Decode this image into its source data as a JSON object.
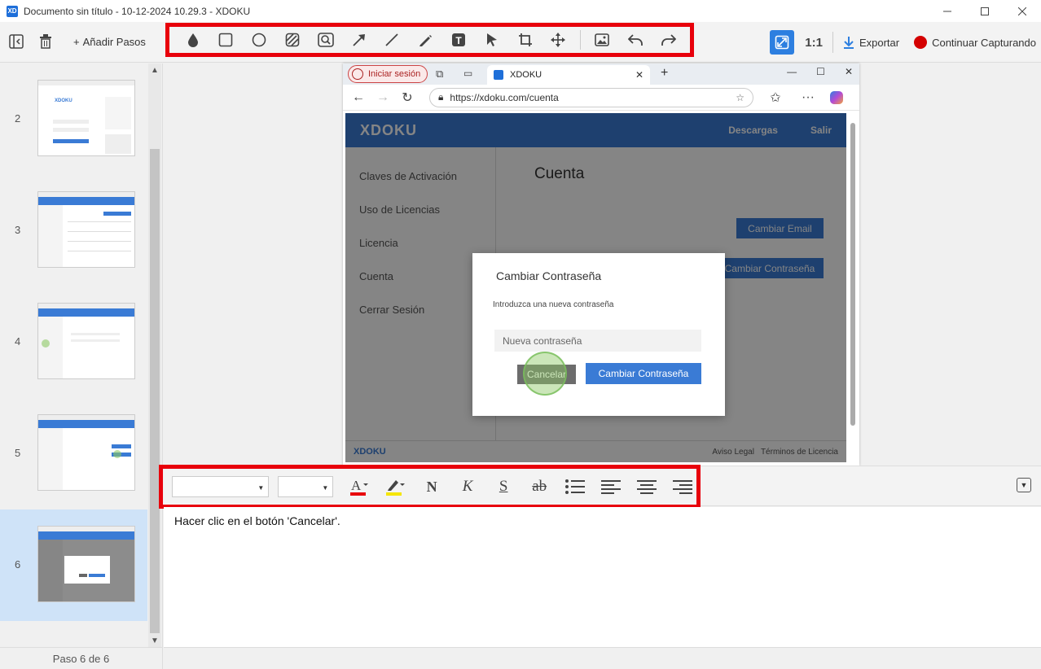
{
  "window": {
    "app_logo": "XD",
    "title": "Documento sin título - 10-12-2024 10.29.3 - XDOKU",
    "minimize_icon": "minimize-icon",
    "maximize_icon": "maximize-icon",
    "close_icon": "close-icon"
  },
  "toolbar": {
    "add_steps_label": "Añadir Pasos",
    "one_to_one_label": "1:1",
    "export_label": "Exportar",
    "continue_capture_label": "Continuar Capturando",
    "accent_color": "#2d7fe0",
    "highlight_border_color": "#e8000b",
    "draw_tools": [
      "drop-icon",
      "rectangle-icon",
      "ellipse-icon",
      "hatch-icon",
      "magnifier-icon",
      "arrow-icon",
      "line-icon",
      "pen-icon",
      "text-icon",
      "cursor-icon",
      "crop-icon",
      "move-icon",
      "image-icon",
      "undo-icon",
      "redo-icon"
    ]
  },
  "sidebar": {
    "steps": [
      {
        "number": "2"
      },
      {
        "number": "3"
      },
      {
        "number": "4"
      },
      {
        "number": "5"
      },
      {
        "number": "6",
        "selected": true
      }
    ],
    "footer": "Paso 6 de 6",
    "selected_color": "#cfe3f8"
  },
  "screenshot": {
    "signin_label": "Iniciar sesión",
    "tab_title": "XDOKU",
    "tab_logo": "XD",
    "url": "https://xdoku.com/cuenta",
    "site": {
      "logo": "XDOKU",
      "nav": [
        "Descargas",
        "Salir"
      ],
      "sidebar_items": [
        "Claves de Activación",
        "Uso de Licencias",
        "Licencia",
        "Cuenta",
        "Cerrar Sesión"
      ],
      "page_title": "Cuenta",
      "change_email_label": "Cambiar Email",
      "change_password_bg_label": "Cambiar Contraseña",
      "footer_logo": "XDOKU",
      "footer_links": [
        "Aviso Legal",
        "Términos de Licencia"
      ],
      "brand_color": "#3a7bd5"
    },
    "dialog": {
      "title": "Cambiar Contraseña",
      "subtitle": "Introduzca una nueva contraseña",
      "input_placeholder": "Nueva contraseña",
      "cancel_label": "Cancelar",
      "confirm_label": "Cambiar Contraseña"
    }
  },
  "format_toolbar": {
    "font_family_value": "",
    "font_size_value": "",
    "tools": [
      "font-color-icon",
      "highlight-icon",
      "bold-icon",
      "italic-icon",
      "underline-icon",
      "strikethrough-icon",
      "bullet-list-icon",
      "align-left-icon",
      "align-center-icon",
      "align-right-icon"
    ],
    "font_color": "#e8000b",
    "highlight_color": "#f5e600",
    "bold_glyph": "N",
    "italic_glyph": "K",
    "underline_glyph": "S",
    "strike_glyph": "ab",
    "font_color_glyph": "A"
  },
  "editor": {
    "step_text": "Hacer clic en el botón 'Cancelar'."
  }
}
